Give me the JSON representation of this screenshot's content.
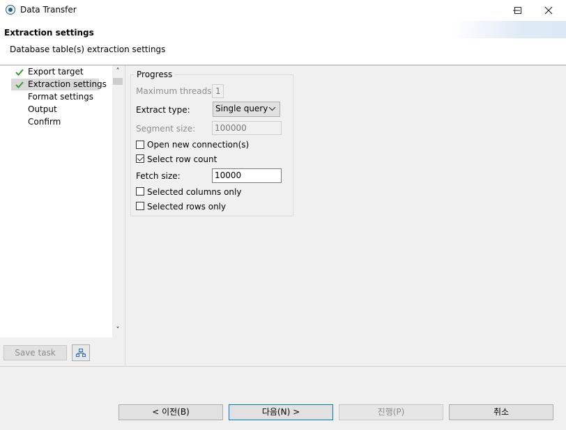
{
  "window": {
    "title": "Data Transfer",
    "minimize_glyph": "—",
    "maximize_glyph": "☐",
    "close_glyph": "✕"
  },
  "header": {
    "title": "Extraction settings",
    "description": "Database table(s) extraction settings"
  },
  "nav": {
    "items": [
      {
        "label": "Export target",
        "done": true,
        "selected": false
      },
      {
        "label": "Extraction settings",
        "done": true,
        "selected": true
      },
      {
        "label": "Format settings",
        "done": false,
        "selected": false
      },
      {
        "label": "Output",
        "done": false,
        "selected": false
      },
      {
        "label": "Confirm",
        "done": false,
        "selected": false
      }
    ]
  },
  "scrollbar": {
    "up_glyph": "˄",
    "down_glyph": "˅"
  },
  "left_actions": {
    "save_task": "Save task",
    "network_icon": "network-icon"
  },
  "progress": {
    "group_label": "Progress",
    "max_threads": {
      "label": "Maximum threads:",
      "value": "1"
    },
    "extract_type": {
      "label": "Extract type:",
      "value": "Single query",
      "chevron": "⌄"
    },
    "segment_size": {
      "label": "Segment size:",
      "value": "100000"
    },
    "open_new_connection": {
      "label": "Open new connection(s)",
      "checked": false
    },
    "select_row_count": {
      "label": "Select row count",
      "checked": true
    },
    "fetch_size": {
      "label": "Fetch size:",
      "value": "10000"
    },
    "selected_columns_only": {
      "label": "Selected columns only",
      "checked": false
    },
    "selected_rows_only": {
      "label": "Selected rows only",
      "checked": false
    }
  },
  "footer": {
    "back": "< 이전(B)",
    "next": "다음(N) >",
    "proceed": "진행(P)",
    "cancel": "취소"
  },
  "colors": {
    "check_green": "#3c9a37",
    "default_border": "#0078d7"
  }
}
